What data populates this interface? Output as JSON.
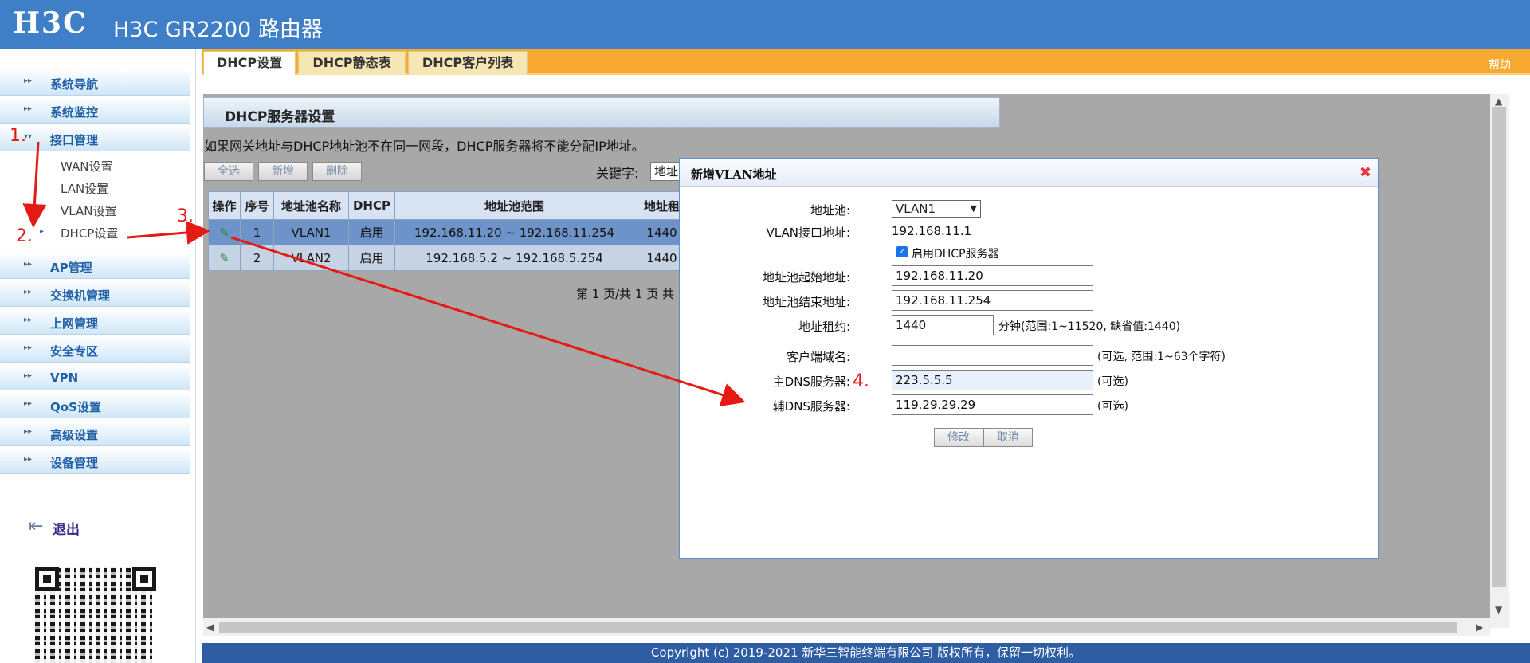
{
  "header": {
    "logo": "H3C",
    "product": "H3C GR2200 路由器"
  },
  "sidebar": {
    "menus": [
      {
        "label": "系统导航"
      },
      {
        "label": "系统监控"
      },
      {
        "label": "接口管理"
      },
      {
        "label": "AP管理"
      },
      {
        "label": "交换机管理"
      },
      {
        "label": "上网管理"
      },
      {
        "label": "安全专区"
      },
      {
        "label": "VPN"
      },
      {
        "label": "QoS设置"
      },
      {
        "label": "高级设置"
      },
      {
        "label": "设备管理"
      }
    ],
    "submenus": [
      {
        "label": "WAN设置"
      },
      {
        "label": "LAN设置"
      },
      {
        "label": "VLAN设置"
      },
      {
        "label": "DHCP设置"
      }
    ],
    "logout": "退出"
  },
  "tabs": [
    {
      "label": "DHCP设置"
    },
    {
      "label": "DHCP静态表"
    },
    {
      "label": "DHCP客户列表"
    }
  ],
  "help": "帮助",
  "section": {
    "title": "DHCP服务器设置"
  },
  "warning": "如果网关地址与DHCP地址池不在同一网段，DHCP服务器将不能分配IP地址。",
  "toolbar": {
    "select_all": "全选",
    "add": "新增",
    "delete": "删除",
    "keyword_label": "关键字:",
    "keyword_value": "地址"
  },
  "table": {
    "headers": [
      "操作",
      "序号",
      "地址池名称",
      "DHCP",
      "地址池范围",
      "地址租"
    ],
    "rows": [
      {
        "index": "1",
        "name": "VLAN1",
        "dhcp": "启用",
        "range": "192.168.11.20 ~ 192.168.11.254",
        "lease": "1440"
      },
      {
        "index": "2",
        "name": "VLAN2",
        "dhcp": "启用",
        "range": "192.168.5.2 ~ 192.168.5.254",
        "lease": "1440"
      }
    ]
  },
  "pager": "第 1 页/共 1 页 共",
  "dialog": {
    "title": "新增VLAN地址",
    "pool_label": "地址池:",
    "pool_value": "VLAN1",
    "vlan_ip_label": "VLAN接口地址:",
    "vlan_ip_value": "192.168.11.1",
    "enable_label": "启用DHCP服务器",
    "start_label": "地址池起始地址:",
    "start_value": "192.168.11.20",
    "end_label": "地址池结束地址:",
    "end_value": "192.168.11.254",
    "lease_label": "地址租约:",
    "lease_value": "1440",
    "lease_hint": "分钟(范围:1~11520, 缺省值:1440)",
    "domain_label": "客户端域名:",
    "domain_value": "",
    "domain_hint": "(可选, 范围:1~63个字符)",
    "dns1_label": "主DNS服务器:",
    "dns1_value": "223.5.5.5",
    "dns1_hint": "(可选)",
    "dns2_label": "辅DNS服务器:",
    "dns2_value": "119.29.29.29",
    "dns2_hint": "(可选)",
    "modify": "修改",
    "cancel": "取消"
  },
  "footer": "Copyright (c) 2019-2021 新华三智能终端有限公司 版权所有，保留一切权利。",
  "annotations": [
    "1.",
    "2.",
    "3.",
    "4."
  ],
  "colors": {
    "header": "#3f7fc8",
    "tab_bar": "#f7a932",
    "footer": "#2f5da3",
    "annotation": "#e41b13",
    "selected_row": "#6d93c8"
  }
}
